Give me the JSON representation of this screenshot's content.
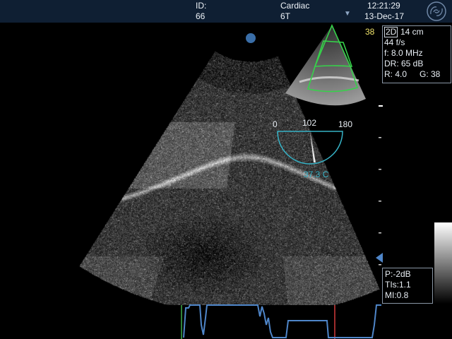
{
  "header": {
    "id_label": "ID:",
    "id_value": "66",
    "exam": "Cardiac",
    "probe": "6T",
    "time": "12:21:29",
    "date": "13-Dec-17",
    "dropdown_glyph": "▼",
    "logo_icon": "ge-logo-icon"
  },
  "imaging": {
    "frame_rate_small": "38",
    "mode": "2D",
    "depth": "14 cm",
    "fps": "44 f/s",
    "freq": "f: 8.0 MHz",
    "dr": "DR: 65 dB",
    "r": "R: 4.0",
    "g": "G: 38"
  },
  "probe_angle": {
    "min": "0",
    "value": "102",
    "max": "180",
    "temperature": "37.3 C"
  },
  "safety": {
    "power": "P:-2dB",
    "tis": "TIs:1.1",
    "mi": "MI:0.8"
  },
  "colors": {
    "topbar": "#0f1f33",
    "accent_teal": "#36b2c6",
    "frame_yellow": "#f0e36a",
    "marker_blue": "#3a6ea8",
    "ecg_blue": "#4f86c9",
    "ecg_red": "#d23a3a",
    "ecg_green": "#3fae4a"
  }
}
